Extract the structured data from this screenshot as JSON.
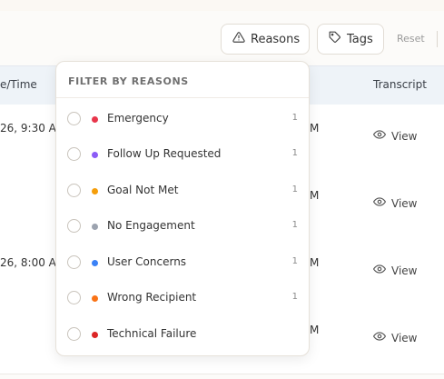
{
  "toolbar": {
    "reasons_label": "Reasons",
    "tags_label": "Tags",
    "reset_label": "Reset"
  },
  "table": {
    "headers": {
      "datetime": "e/Time",
      "transcript": "Transcript"
    },
    "rows": [
      {
        "datetime": "26, 9:30 AM",
        "am": "M",
        "view": "View"
      },
      {
        "datetime": "",
        "am": "M",
        "view": "View"
      },
      {
        "datetime": "26, 8:00 AM",
        "am": "M",
        "view": "View"
      },
      {
        "datetime": "",
        "am": "M",
        "view": "View"
      }
    ]
  },
  "dropdown": {
    "header": "FILTER BY REASONS",
    "options": [
      {
        "label": "Emergency",
        "count": "1",
        "color": "#e8364b"
      },
      {
        "label": "Follow Up Requested",
        "count": "1",
        "color": "#8b5cf6"
      },
      {
        "label": "Goal Not Met",
        "count": "1",
        "color": "#f59e0b"
      },
      {
        "label": "No Engagement",
        "count": "1",
        "color": "#9ca3af"
      },
      {
        "label": "User Concerns",
        "count": "1",
        "color": "#3b82f6"
      },
      {
        "label": "Wrong Recipient",
        "count": "1",
        "color": "#f97316"
      },
      {
        "label": "Technical Failure",
        "count": "",
        "color": "#dc2626"
      }
    ]
  },
  "icons": {
    "reasons": "warning-triangle-icon",
    "tags": "tag-icon",
    "view": "eye-icon"
  }
}
